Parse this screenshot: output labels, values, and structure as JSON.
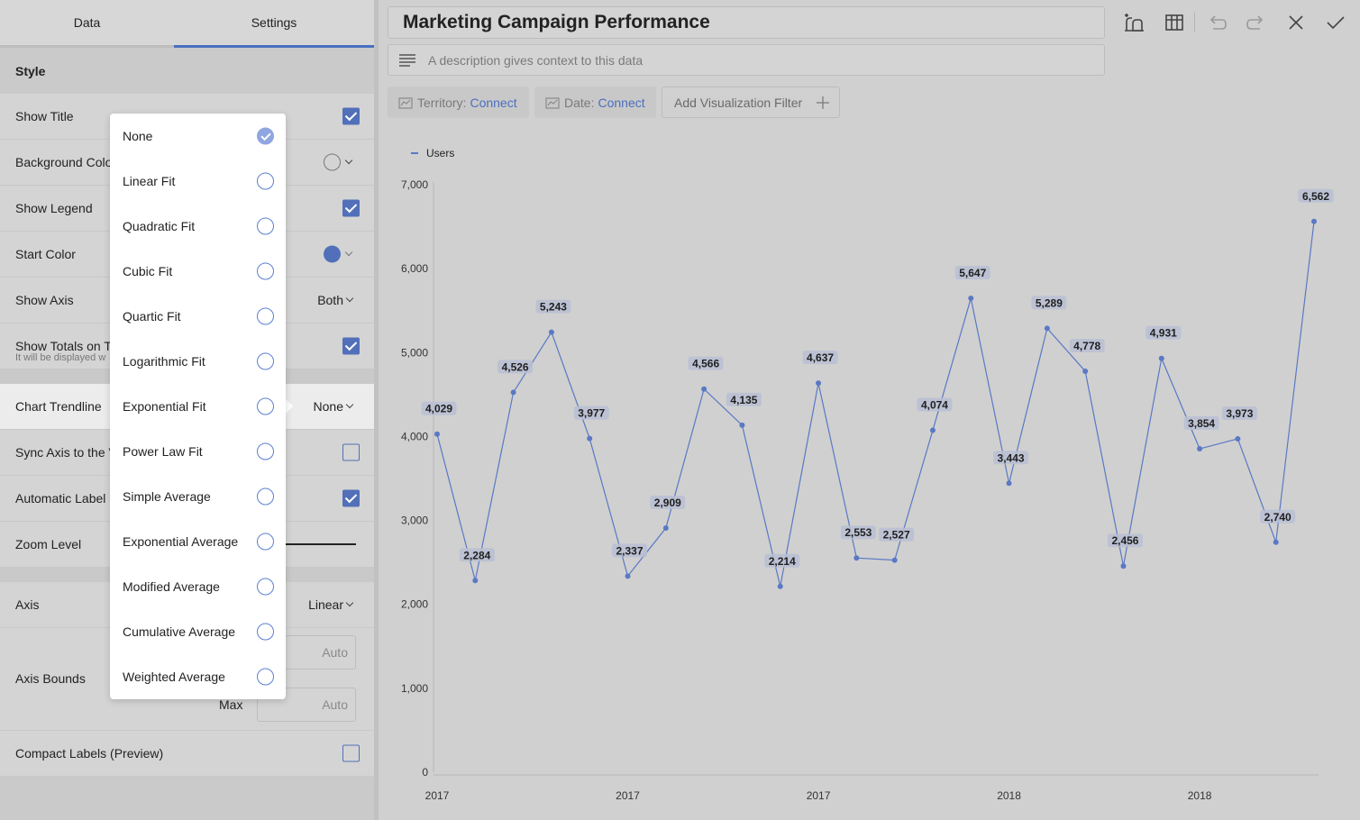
{
  "tabs": {
    "data": "Data",
    "settings": "Settings"
  },
  "settings": {
    "style_heading": "Style",
    "show_title": "Show Title",
    "background_color": "Background Colo",
    "show_legend": "Show Legend",
    "start_color": "Start Color",
    "start_color_value": "#5270b9",
    "show_axis": "Show Axis",
    "show_axis_value": "Both",
    "show_totals": "Show Totals on T",
    "show_totals_sub": "It will be displayed w",
    "chart_trendline": "Chart Trendline",
    "chart_trendline_value": "None",
    "sync_axis": "Sync Axis to the V",
    "automatic_label": "Automatic Label",
    "zoom_level": "Zoom Level",
    "axis": "Axis",
    "axis_value": "Linear",
    "axis_bounds": "Axis Bounds",
    "min_placeholder": "Auto",
    "max_label": "Max",
    "max_placeholder": "Auto",
    "compact_labels": "Compact Labels (Preview)"
  },
  "dropdown": {
    "options": [
      "None",
      "Linear Fit",
      "Quadratic Fit",
      "Cubic Fit",
      "Quartic Fit",
      "Logarithmic Fit",
      "Exponential Fit",
      "Power Law Fit",
      "Simple Average",
      "Exponential Average",
      "Modified Average",
      "Cumulative Average",
      "Weighted Average"
    ],
    "selected": "None"
  },
  "header": {
    "title": "Marketing Campaign Performance",
    "description_placeholder": "A description gives context to this data"
  },
  "filters": {
    "territory_label": "Territory:",
    "territory_link": "Connect",
    "date_label": "Date:",
    "date_link": "Connect",
    "add": "Add Visualization Filter"
  },
  "colors": {
    "accent": "#4a6fc0",
    "series": "#5a78c4"
  },
  "chart_data": {
    "type": "line",
    "legend": [
      "Users"
    ],
    "legend_position": "top-left",
    "series": [
      {
        "name": "Users",
        "values": [
          4029,
          2284,
          4526,
          5243,
          3977,
          2337,
          2909,
          4566,
          4135,
          2214,
          4637,
          2553,
          2527,
          4074,
          5647,
          3443,
          5289,
          4778,
          2456,
          4931,
          3854,
          3973,
          2740,
          6562
        ]
      }
    ],
    "x_tick_labels": [
      "2017",
      "2017",
      "2017",
      "2018",
      "2018"
    ],
    "y_ticks": [
      "0",
      "1,000",
      "2,000",
      "3,000",
      "4,000",
      "5,000",
      "6,000",
      "7,000"
    ],
    "ylim": [
      0,
      7000
    ],
    "data_labels": true,
    "grid": false
  }
}
